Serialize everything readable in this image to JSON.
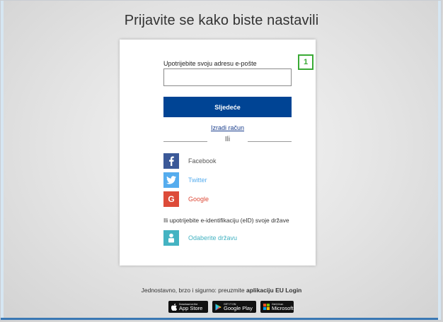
{
  "title": "Prijavite se kako biste nastavili",
  "step_badge": "1",
  "email": {
    "label": "Upotrijebite svoju adresu e-pošte",
    "value": "",
    "placeholder": ""
  },
  "next_button": "Sljedeće",
  "create_account_link": "Izradi račun",
  "divider_text": "Ili",
  "social": [
    {
      "label": "Facebook",
      "icon": "facebook-icon",
      "color": "#3b5998",
      "text_color": "#555555"
    },
    {
      "label": "Twitter",
      "icon": "twitter-icon",
      "color": "#55acee",
      "text_color": "#55acee"
    },
    {
      "label": "Google",
      "icon": "google-icon",
      "color": "#dd4b39",
      "text_color": "#dd4b39"
    }
  ],
  "eid": {
    "text": "Ili upotrijebite e-identifikaciju (eID) svoje države",
    "button": "Odaberite državu",
    "icon": "person-icon",
    "color": "#44b3c2"
  },
  "footer": {
    "text_prefix": "Jednostavno, brzo i sigurno: preuzmite ",
    "text_bold": "aplikaciju EU Login"
  },
  "stores": [
    {
      "small": "Download on the",
      "big": "App Store",
      "icon": "apple-icon"
    },
    {
      "small": "GET IT ON",
      "big": "Google Play",
      "icon": "google-play-icon"
    },
    {
      "small": "Get it from",
      "big": "Microsoft",
      "icon": "microsoft-icon"
    }
  ],
  "colors": {
    "primary": "#004494",
    "badge_green": "#3aaa35"
  }
}
